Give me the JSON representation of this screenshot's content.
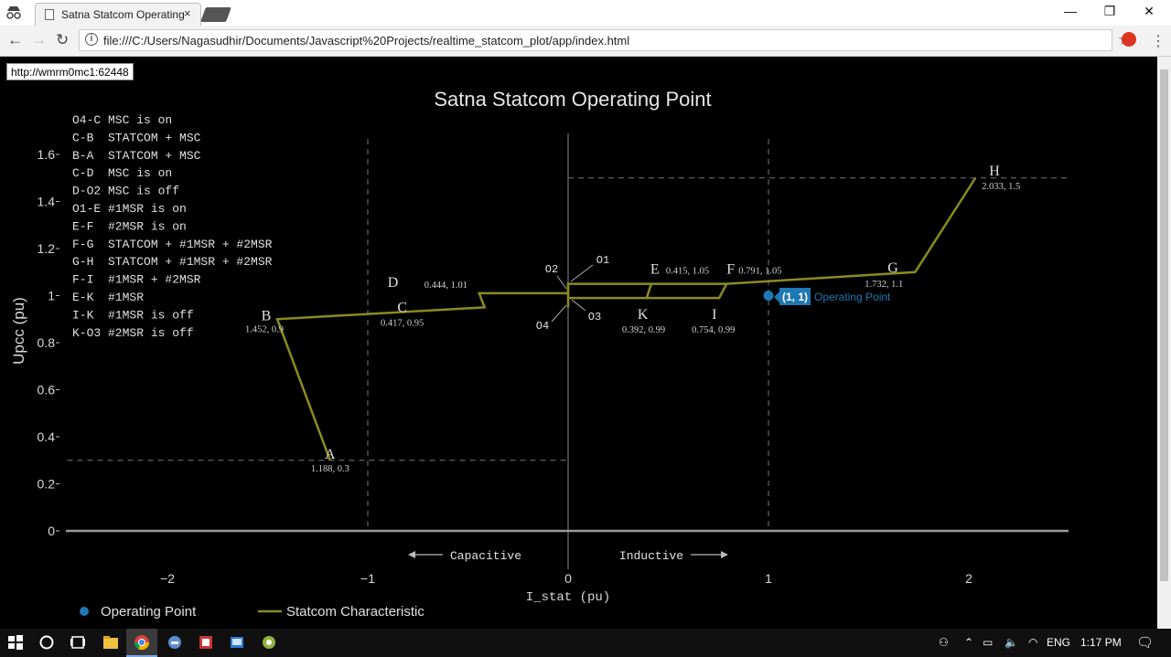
{
  "browser": {
    "tab_title": "Satna Statcom Operating",
    "tab_close": "×",
    "url": "file:///C:/Users/Nagasudhir/Documents/Javascript%20Projects/realtime_statcom_plot/app/index.html",
    "status_url": "http://wmrm0mc1:62448",
    "icons": [
      "back-icon",
      "forward-icon",
      "reload-icon",
      "info-icon",
      "star-icon",
      "menu-icon"
    ]
  },
  "plot": {
    "title": "Satna Statcom Operating Point",
    "xlabel": "I_stat (pu)",
    "ylabel": "Upcc (pu)",
    "xticks": [
      "−2",
      "−1",
      "0",
      "1",
      "2"
    ],
    "yticks": [
      "0",
      "0.2",
      "0.4",
      "0.6",
      "0.8",
      "1",
      "1.2",
      "1.4",
      "1.6"
    ],
    "capacitive_label": "Capacitive",
    "inductive_label": "Inductive",
    "legend_operating": "Operating Point",
    "legend_characteristic": "Statcom Characteristic",
    "operating_hover": "(1, 1)",
    "operating_hover_name": "Operating Point",
    "notes": [
      "O4-C MSC is on",
      "C-B  STATCOM + MSC",
      "B-A  STATCOM + MSC",
      "C-D  MSC is on",
      "D-O2 MSC is off",
      "O1-E #1MSR is on",
      "E-F  #2MSR is on",
      "F-G  STATCOM + #1MSR + #2MSR",
      "G-H  STATCOM + #1MSR + #2MSR",
      "F-I  #1MSR + #2MSR",
      "E-K  #1MSR",
      "I-K  #1MSR is off",
      "K-O3 #2MSR is off"
    ],
    "colors": {
      "characteristic": "#8b8b1f",
      "operating": "#1f77b4",
      "text": "#d9d9d9",
      "axis": "#999999"
    }
  },
  "chart_data": {
    "type": "line",
    "title": "Satna Statcom Operating Point",
    "xlabel": "I_stat (pu)",
    "ylabel": "Upcc (pu)",
    "xlim": [
      -2.5,
      2.5
    ],
    "ylim": [
      -0.05,
      1.72
    ],
    "series": [
      {
        "name": "Statcom Characteristic",
        "x": [
          -1.188,
          -1.452,
          -0.417,
          -0.444,
          0,
          0,
          0.415,
          0.791,
          1.732,
          2.033
        ],
        "y": [
          0.3,
          0.9,
          0.95,
          1.01,
          1.01,
          1.05,
          1.05,
          1.05,
          1.1,
          1.5
        ]
      },
      {
        "name": "Statcom Characteristic",
        "x": [
          0,
          0.392,
          0.754,
          0.791
        ],
        "y": [
          0.99,
          0.99,
          0.99,
          1.05
        ]
      },
      {
        "name": "Statcom Characteristic",
        "x": [
          0.392,
          0.415
        ],
        "y": [
          0.99,
          1.05
        ]
      },
      {
        "name": "Statcom Characteristic",
        "x": [
          0,
          0
        ],
        "y": [
          0.95,
          1.05
        ]
      },
      {
        "name": "Operating Point",
        "x": [
          1
        ],
        "y": [
          1
        ]
      }
    ],
    "points": [
      {
        "label": "A",
        "x": -1.188,
        "y": 0.3,
        "coords": "1.188, 0.3"
      },
      {
        "label": "B",
        "x": -1.452,
        "y": 0.9,
        "coords": "1.452, 0.9"
      },
      {
        "label": "C",
        "x": -0.417,
        "y": 0.95,
        "coords": "0.417, 0.95"
      },
      {
        "label": "D",
        "x": -0.444,
        "y": 1.01,
        "coords": "0.444, 1.01"
      },
      {
        "label": "E",
        "x": 0.415,
        "y": 1.05,
        "coords": "0.415, 1.05"
      },
      {
        "label": "F",
        "x": 0.791,
        "y": 1.05,
        "coords": "0.791, 1.05"
      },
      {
        "label": "G",
        "x": 1.732,
        "y": 1.1,
        "coords": "1.732, 1.1"
      },
      {
        "label": "H",
        "x": 2.033,
        "y": 1.5,
        "coords": "2.033, 1.5"
      },
      {
        "label": "I",
        "x": 0.754,
        "y": 0.99,
        "coords": "0.754, 0.99"
      },
      {
        "label": "K",
        "x": 0.392,
        "y": 0.99,
        "coords": "0.392, 0.99"
      }
    ],
    "origin_labels": [
      "O1",
      "O2",
      "O3",
      "O4"
    ],
    "reference_lines": {
      "vertical_x": [
        -1,
        1
      ],
      "horizontal": [
        {
          "y": 0.3,
          "x_from": -2.5,
          "x_to": 0
        },
        {
          "y": 1.5,
          "x_from": 0,
          "x_to": 2.5
        }
      ]
    },
    "grid": false,
    "legend": "bottom-left"
  },
  "taskbar": {
    "time": "1:17 PM",
    "language": "ENG",
    "icons": [
      "windows-start-icon",
      "cortana-icon",
      "task-view-icon",
      "file-explorer-icon",
      "chrome-icon",
      "app-icon",
      "app-icon",
      "app-icon",
      "app-icon"
    ]
  }
}
